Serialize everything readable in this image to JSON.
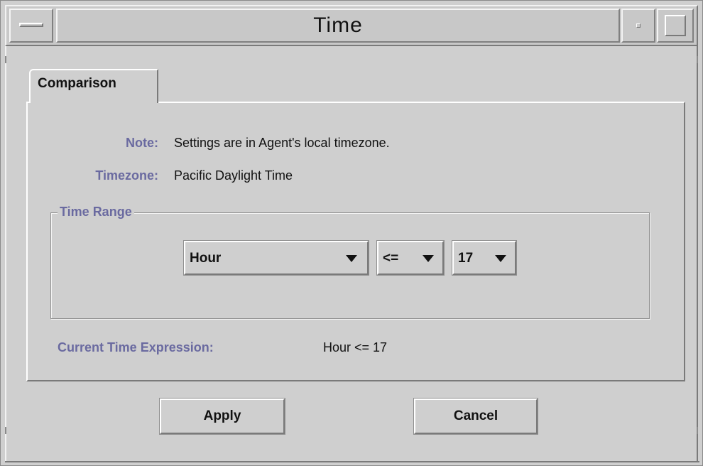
{
  "window": {
    "title": "Time"
  },
  "tabs": [
    {
      "label": "Comparison",
      "selected": true
    }
  ],
  "info": {
    "note_label": "Note:",
    "note_value": "Settings are in Agent's local timezone.",
    "timezone_label": "Timezone:",
    "timezone_value": "Pacific Daylight Time"
  },
  "time_range": {
    "title": "Time Range",
    "field_select": {
      "selected": "Hour"
    },
    "operator_select": {
      "selected": "<="
    },
    "value_select": {
      "selected": "17"
    }
  },
  "expression": {
    "label": "Current Time Expression:",
    "value": "Hour <= 17"
  },
  "buttons": {
    "apply": "Apply",
    "cancel": "Cancel"
  },
  "colors": {
    "label_accent": "#6a6aa0",
    "background": "#cfcfcf"
  }
}
